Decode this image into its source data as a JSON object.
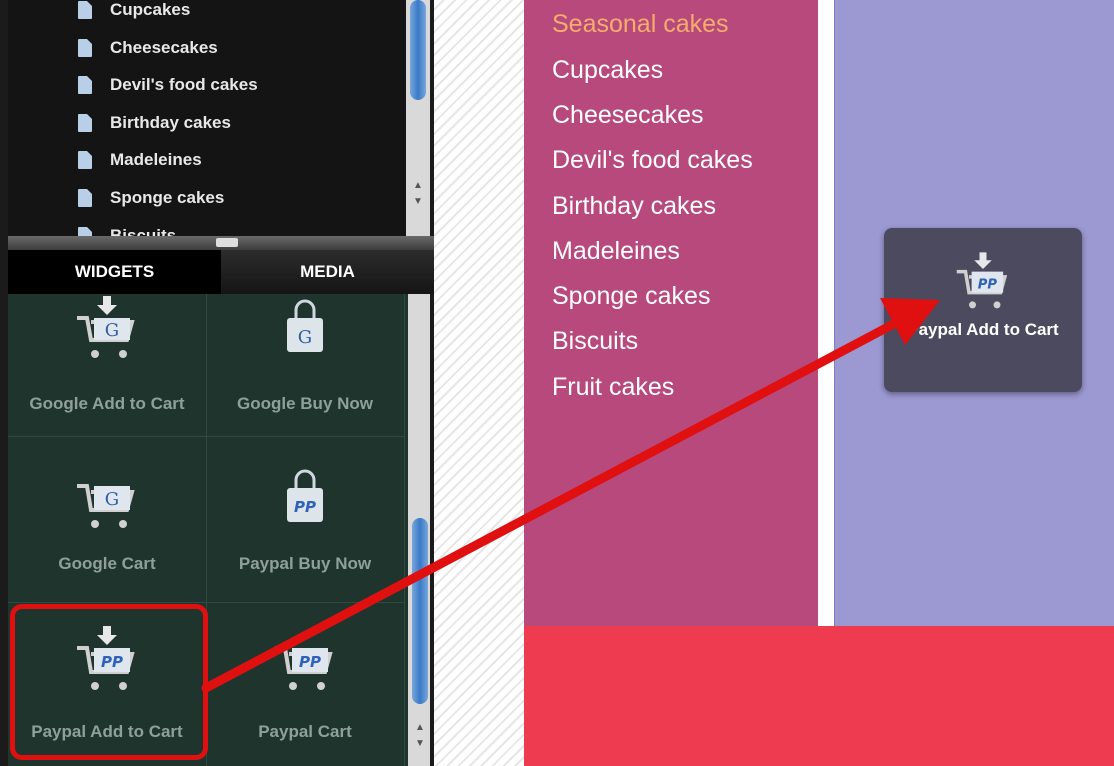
{
  "pages_list": {
    "items": [
      "Cupcakes",
      "Cheesecakes",
      "Devil's food cakes",
      "Birthday cakes",
      "Madeleines",
      "Sponge cakes",
      "Biscuits"
    ]
  },
  "panel_tabs": {
    "widgets_label": "WIDGETS",
    "media_label": "MEDIA"
  },
  "widgets": {
    "google_add_to_cart": "Google Add to Cart",
    "google_buy_now": "Google Buy Now",
    "google_cart": "Google Cart",
    "paypal_buy_now": "Paypal Buy Now",
    "paypal_add_to_cart": "Paypal Add to Cart",
    "paypal_cart": "Paypal Cart",
    "google_glyph": "G",
    "paypal_glyph": "PP"
  },
  "site_nav": {
    "items": [
      "Seasonal cakes",
      "Cupcakes",
      "Cheesecakes",
      "Devil's food cakes",
      "Birthday cakes",
      "Madeleines",
      "Sponge cakes",
      "Biscuits",
      "Fruit cakes"
    ],
    "active_index": 0
  },
  "dragged_widget": {
    "label": "Paypal Add to Cart",
    "glyph": "PP"
  },
  "colors": {
    "sidebar": "#b8497c",
    "content": "#9b98d2",
    "footer": "#ee3b4f",
    "nav_accent": "#f4ad6a",
    "highlight": "#e01010"
  }
}
